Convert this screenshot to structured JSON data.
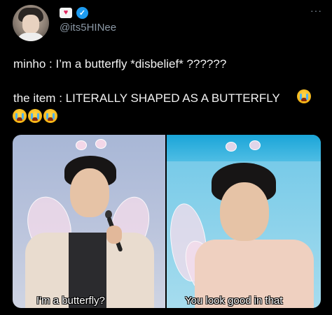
{
  "author": {
    "handle": "@its5HINee",
    "avatar_icon": "profile-photo",
    "badges": [
      "heart-badge-icon",
      "verified-badge-icon"
    ],
    "verified_color": "#1d9bf0"
  },
  "menu": {
    "more_label": "···"
  },
  "tweet": {
    "line1": "minho : I’m a butterfly *disbelief* ??????",
    "line2": "the item : LITERALLY SHAPED AS A BUTTERFLY",
    "emoji": "loudly-crying-face-icon",
    "trailing_emoji_count": 3
  },
  "photos": [
    {
      "caption": "I'm a butterfly?"
    },
    {
      "caption": "You look good in that"
    }
  ]
}
